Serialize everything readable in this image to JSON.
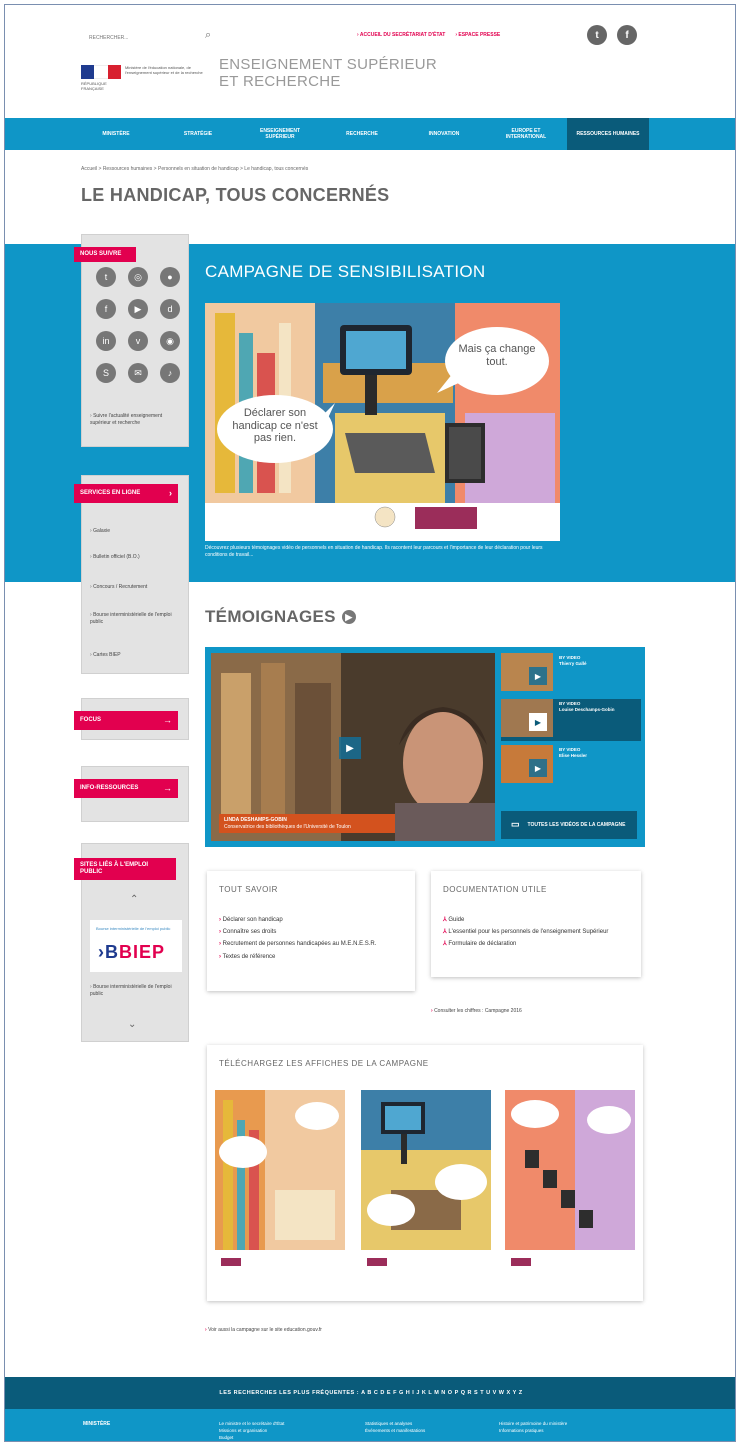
{
  "header": {
    "search_placeholder": "RECHERCHER...",
    "top_links": [
      "ACCUEIL DU SECRÉTARIAT D'ÉTAT",
      "ESPACE PRESSE"
    ],
    "republique": "RÉPUBLIQUE FRANÇAISE",
    "ministry": "Ministère de l'éducation nationale, de l'enseignement supérieur et de la recherche",
    "site_title_1": "ENSEIGNEMENT SUPÉRIEUR",
    "site_title_2": "ET RECHERCHE"
  },
  "nav": {
    "items": [
      "MINISTÈRE",
      "STRATÉGIE",
      "ENSEIGNEMENT SUPÉRIEUR",
      "RECHERCHE",
      "INNOVATION",
      "EUROPE ET INTERNATIONAL",
      "RESSOURCES HUMAINES"
    ],
    "active_index": 6
  },
  "breadcrumb": "Accueil > Ressources humaines > Personnels en situation de handicap > Le handicap, tous concernés",
  "page_title": "LE HANDICAP, TOUS CONCERNÉS",
  "sidebar": {
    "follow": {
      "title": "NOUS SUIVRE",
      "link": "Suivre l'actualité enseignement supérieur et recherche"
    },
    "services": {
      "title": "SERVICES EN LIGNE",
      "links": [
        "Galaxie",
        "Bulletin officiel (B.O.)",
        "Concours / Recrutement",
        "Bourse interministérielle de l'emploi public",
        "Cartes BIEP"
      ]
    },
    "focus": {
      "title": "FOCUS"
    },
    "info": {
      "title": "INFO-RESSOURCES"
    },
    "emploi": {
      "title": "SITES LIÉS À L'EMPLOI PUBLIC",
      "biep_tagline": "Bourse interministérielle de l'emploi public",
      "biep_logo": "BIEP",
      "link": "Bourse interministérielle de l'emploi public"
    }
  },
  "campaign": {
    "title": "CAMPAGNE DE SENSIBILISATION",
    "bubble_left": "Déclarer son handicap ce n'est pas rien.",
    "bubble_right": "Mais ça change tout.",
    "desc": "Découvrez plusieurs témoignages vidéo de personnels en situation de handicap. Ils racontent leur parcours et l'importance de leur déclaration pour leurs conditions de travail..."
  },
  "temoignages": {
    "title": "TÉMOIGNAGES",
    "caption_name": "LINDA DESHAMPS-GOBIN",
    "caption_role": "Conservatrice des bibliothèques de l'Université de Toulon",
    "thumbs": [
      {
        "label": "BY VIDEO",
        "name": "Thierry Gallé"
      },
      {
        "label": "BY VIDEO",
        "name": "Louise Deschamps-Gobin"
      },
      {
        "label": "BY VIDEO",
        "name": "Elise Hessler"
      }
    ],
    "all_videos": "TOUTES LES VIDÉOS DE LA CAMPAGNE"
  },
  "tout_savoir": {
    "title": "TOUT SAVOIR",
    "items": [
      "Déclarer son handicap",
      "Connaître ses droits",
      "Recrutement de personnes handicapées au M.E.N.E.S.R.",
      "Textes de référence"
    ]
  },
  "documentation": {
    "title": "DOCUMENTATION UTILE",
    "items": [
      "Guide",
      "L'essentiel pour les personnels de l'enseignement Supérieur",
      "Formulaire de déclaration"
    ]
  },
  "consult_link": "Consulter les chiffres : Campagne 2016",
  "affiches": {
    "title": "TÉLÉCHARGEZ LES AFFICHES DE LA CAMPAGNE"
  },
  "bottom_link": "Voir aussi la campagne sur le site education.gouv.fr",
  "footer": {
    "search_label": "LES RECHERCHES LES PLUS FRÉQUENTES :",
    "alphabet": "A B C D E F G H I J K L M N O P Q R S T U V W X Y Z",
    "col_title": "MINISTÈRE",
    "col1": [
      "Le ministre et le secrétaire d'État",
      "Missions et organisation",
      "Budget"
    ],
    "col2": [
      "Statistiques et analyses",
      "Événements et manifestations"
    ],
    "col3": [
      "Histoire et patrimoine du ministère",
      "Informations pratiques"
    ]
  }
}
